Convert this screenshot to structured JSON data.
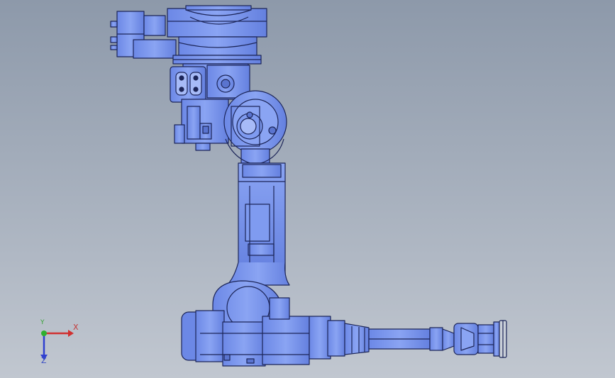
{
  "viewport": {
    "background_top": "#8d99aa",
    "background_bottom": "#c1c7d0",
    "model": {
      "name": "industrial-robot-arm",
      "body_color": "#7f9bf0",
      "edge_color": "#1c2558",
      "shade_color": "#5a74cf",
      "highlight_color": "#a7bbf7"
    }
  },
  "triad": {
    "x_label": "X",
    "y_label": "Y",
    "z_label": "Z",
    "x_color": "#d03030",
    "y_color": "#30b030",
    "z_color": "#3040d0"
  }
}
